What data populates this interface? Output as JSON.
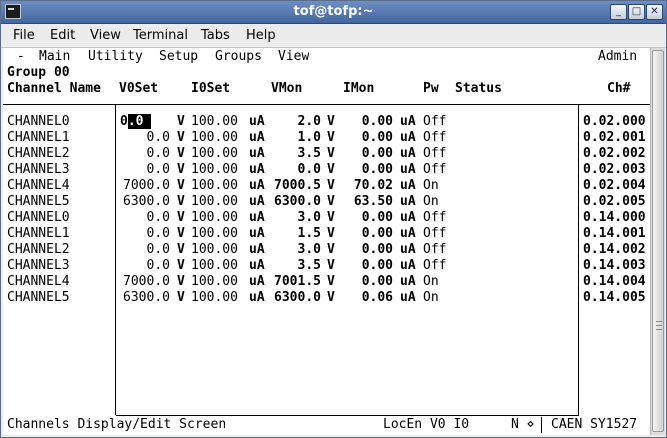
{
  "window": {
    "title": "tof@tofp:~",
    "buttons": {
      "minimize": "_",
      "maximize": "□",
      "close": "✕"
    }
  },
  "menubar": [
    "File",
    "Edit",
    "View",
    "Terminal",
    "Tabs",
    "Help"
  ],
  "app_menu": {
    "dash": "-",
    "items": [
      "Main",
      "Utility",
      "Setup",
      "Groups",
      "View"
    ],
    "user": "Admin"
  },
  "group_label": "Group 00",
  "headers": {
    "name": "Channel Name",
    "v0set": "V0Set",
    "i0set": "I0Set",
    "vmon": "VMon",
    "imon": "IMon",
    "pw": "Pw",
    "status": "Status",
    "ch": "Ch#"
  },
  "cursor_value": {
    "pre": "0",
    "sel": ".0"
  },
  "rows": [
    {
      "name": "CHANNEL0",
      "v0set": "0.0",
      "v0unit": "V",
      "i0set": "100.00",
      "i0unit": "uA",
      "vmon": "2.0",
      "vunit": "V",
      "imon": "0.00",
      "iunit": "uA",
      "pw": "Off",
      "status": "",
      "ch": "0.02.000"
    },
    {
      "name": "CHANNEL1",
      "v0set": "0.0",
      "v0unit": "V",
      "i0set": "100.00",
      "i0unit": "uA",
      "vmon": "1.0",
      "vunit": "V",
      "imon": "0.00",
      "iunit": "uA",
      "pw": "Off",
      "status": "",
      "ch": "0.02.001"
    },
    {
      "name": "CHANNEL2",
      "v0set": "0.0",
      "v0unit": "V",
      "i0set": "100.00",
      "i0unit": "uA",
      "vmon": "3.5",
      "vunit": "V",
      "imon": "0.00",
      "iunit": "uA",
      "pw": "Off",
      "status": "",
      "ch": "0.02.002"
    },
    {
      "name": "CHANNEL3",
      "v0set": "0.0",
      "v0unit": "V",
      "i0set": "100.00",
      "i0unit": "uA",
      "vmon": "0.0",
      "vunit": "V",
      "imon": "0.00",
      "iunit": "uA",
      "pw": "Off",
      "status": "",
      "ch": "0.02.003"
    },
    {
      "name": "CHANNEL4",
      "v0set": "7000.0",
      "v0unit": "V",
      "i0set": "100.00",
      "i0unit": "uA",
      "vmon": "7000.5",
      "vunit": "V",
      "imon": "70.02",
      "iunit": "uA",
      "pw": "On",
      "status": "",
      "ch": "0.02.004"
    },
    {
      "name": "CHANNEL5",
      "v0set": "6300.0",
      "v0unit": "V",
      "i0set": "100.00",
      "i0unit": "uA",
      "vmon": "6300.0",
      "vunit": "V",
      "imon": "63.50",
      "iunit": "uA",
      "pw": "On",
      "status": "",
      "ch": "0.02.005"
    },
    {
      "name": "CHANNEL0",
      "v0set": "0.0",
      "v0unit": "V",
      "i0set": "100.00",
      "i0unit": "uA",
      "vmon": "3.0",
      "vunit": "V",
      "imon": "0.00",
      "iunit": "uA",
      "pw": "Off",
      "status": "",
      "ch": "0.14.000"
    },
    {
      "name": "CHANNEL1",
      "v0set": "0.0",
      "v0unit": "V",
      "i0set": "100.00",
      "i0unit": "uA",
      "vmon": "1.5",
      "vunit": "V",
      "imon": "0.00",
      "iunit": "uA",
      "pw": "Off",
      "status": "",
      "ch": "0.14.001"
    },
    {
      "name": "CHANNEL2",
      "v0set": "0.0",
      "v0unit": "V",
      "i0set": "100.00",
      "i0unit": "uA",
      "vmon": "3.0",
      "vunit": "V",
      "imon": "0.00",
      "iunit": "uA",
      "pw": "Off",
      "status": "",
      "ch": "0.14.002"
    },
    {
      "name": "CHANNEL3",
      "v0set": "0.0",
      "v0unit": "V",
      "i0set": "100.00",
      "i0unit": "uA",
      "vmon": "3.5",
      "vunit": "V",
      "imon": "0.00",
      "iunit": "uA",
      "pw": "Off",
      "status": "",
      "ch": "0.14.003"
    },
    {
      "name": "CHANNEL4",
      "v0set": "7000.0",
      "v0unit": "V",
      "i0set": "100.00",
      "i0unit": "uA",
      "vmon": "7001.5",
      "vunit": "V",
      "imon": "0.00",
      "iunit": "uA",
      "pw": "On",
      "status": "",
      "ch": "0.14.004"
    },
    {
      "name": "CHANNEL5",
      "v0set": "6300.0",
      "v0unit": "V",
      "i0set": "100.00",
      "i0unit": "uA",
      "vmon": "6300.0",
      "vunit": "V",
      "imon": "0.06",
      "iunit": "uA",
      "pw": "On",
      "status": "",
      "ch": "0.14.005"
    }
  ],
  "statusbar": {
    "screen": "Channels Display/Edit Screen",
    "mode": "LocEn V0 I0",
    "flag": "N ⋄",
    "device": "CAEN SY1527"
  }
}
